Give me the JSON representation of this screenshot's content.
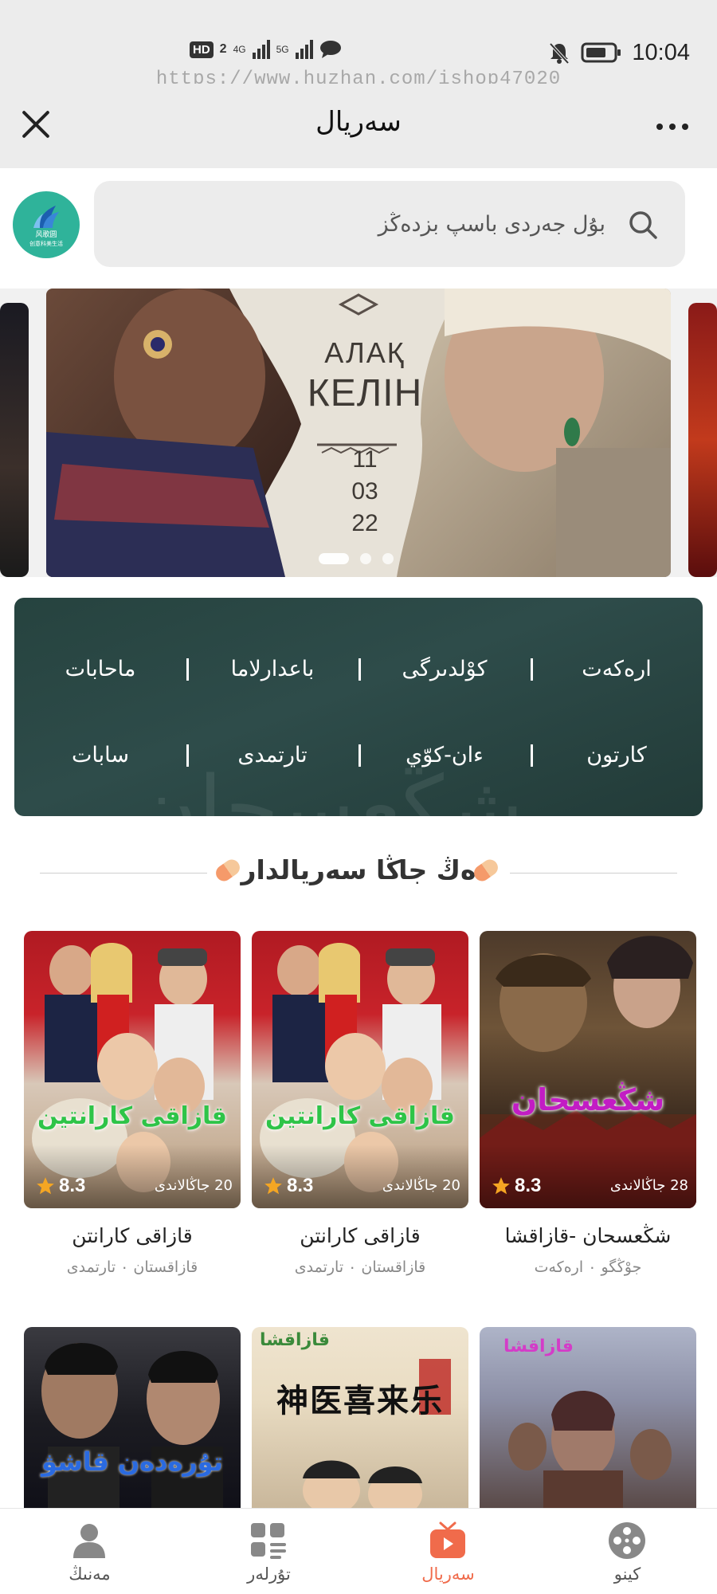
{
  "status_bar": {
    "time": "10:04",
    "network_badge": "HD",
    "sim_slot": "2",
    "network_1": "4G",
    "network_2": "5G",
    "icons": [
      "signal-icon",
      "chat-bubble-icon",
      "mute-bell-icon",
      "battery-icon"
    ]
  },
  "watermark": "https://www.huzhan.com/ishop47020",
  "header": {
    "title": "سەريال",
    "close_icon": "close-icon",
    "more_icon": "more-dots-icon"
  },
  "logo": {
    "text_line1": "风歌圆",
    "text_line2": "创意科美生活"
  },
  "search": {
    "placeholder": "بۇل جەردى باسپ بزدەڭز"
  },
  "banner": {
    "caption_line1": "АЛАҚ",
    "caption_line2": "КЕЛІН",
    "date_lines": [
      "11",
      "03",
      "22"
    ],
    "slide_count": 3,
    "active_slide": 1
  },
  "categories": {
    "row1": [
      "ارەكەت",
      "كوْلدىرگى",
      "باعدارلاما",
      "ماحابات"
    ],
    "row2": [
      "كارتون",
      "ءان-كوّي",
      "تارتمدى",
      "سابات"
    ],
    "background_text": "شڭعسحان"
  },
  "section": {
    "title": "ەڭ جاڭا سەريالدار"
  },
  "cards": [
    {
      "title": "شڭعسحان -قازاقشا",
      "meta": "جوْڭگو ۰ ارەكەت",
      "rating": "8.3",
      "episodes": "28 جاڭالاندى",
      "poster_text": "شڭعسحان",
      "poster_color": "#c21cc4"
    },
    {
      "title": "قازاقى كارانتن",
      "meta": "قازاقستان ۰ تارتمدى",
      "rating": "8.3",
      "episodes": "20 جاڭالاندى",
      "poster_text": "قازاقى كارانتين",
      "poster_color": "#2ec448"
    },
    {
      "title": "قازاقى كارانتن",
      "meta": "قازاقستان ۰ تارتمدى",
      "rating": "8.3",
      "episodes": "20 جاڭالاندى",
      "poster_text": "قازاقى كارانتين",
      "poster_color": "#2ec448"
    },
    {
      "poster_text": "قازاقشا",
      "poster_color": "#d43cc8"
    },
    {
      "poster_text": "قازاقشا",
      "poster_text2": "神医喜来乐",
      "poster_color": "#3a8a3a"
    },
    {
      "poster_text": "تۇرەدەن قاشۋ",
      "poster_color": "#2a6ae0"
    }
  ],
  "bottom_nav": [
    {
      "label": "كينو",
      "icon": "film-reel-icon",
      "active": false
    },
    {
      "label": "سەريال",
      "icon": "tv-play-icon",
      "active": true
    },
    {
      "label": "تۇرلەر",
      "icon": "grid-list-icon",
      "active": false
    },
    {
      "label": "مەنىڭ",
      "icon": "user-icon",
      "active": false
    }
  ],
  "colors": {
    "accent": "#f06b4b",
    "header_bg": "#ececec",
    "category_panel": "#2b4845",
    "rating_star": "#f5a623"
  }
}
